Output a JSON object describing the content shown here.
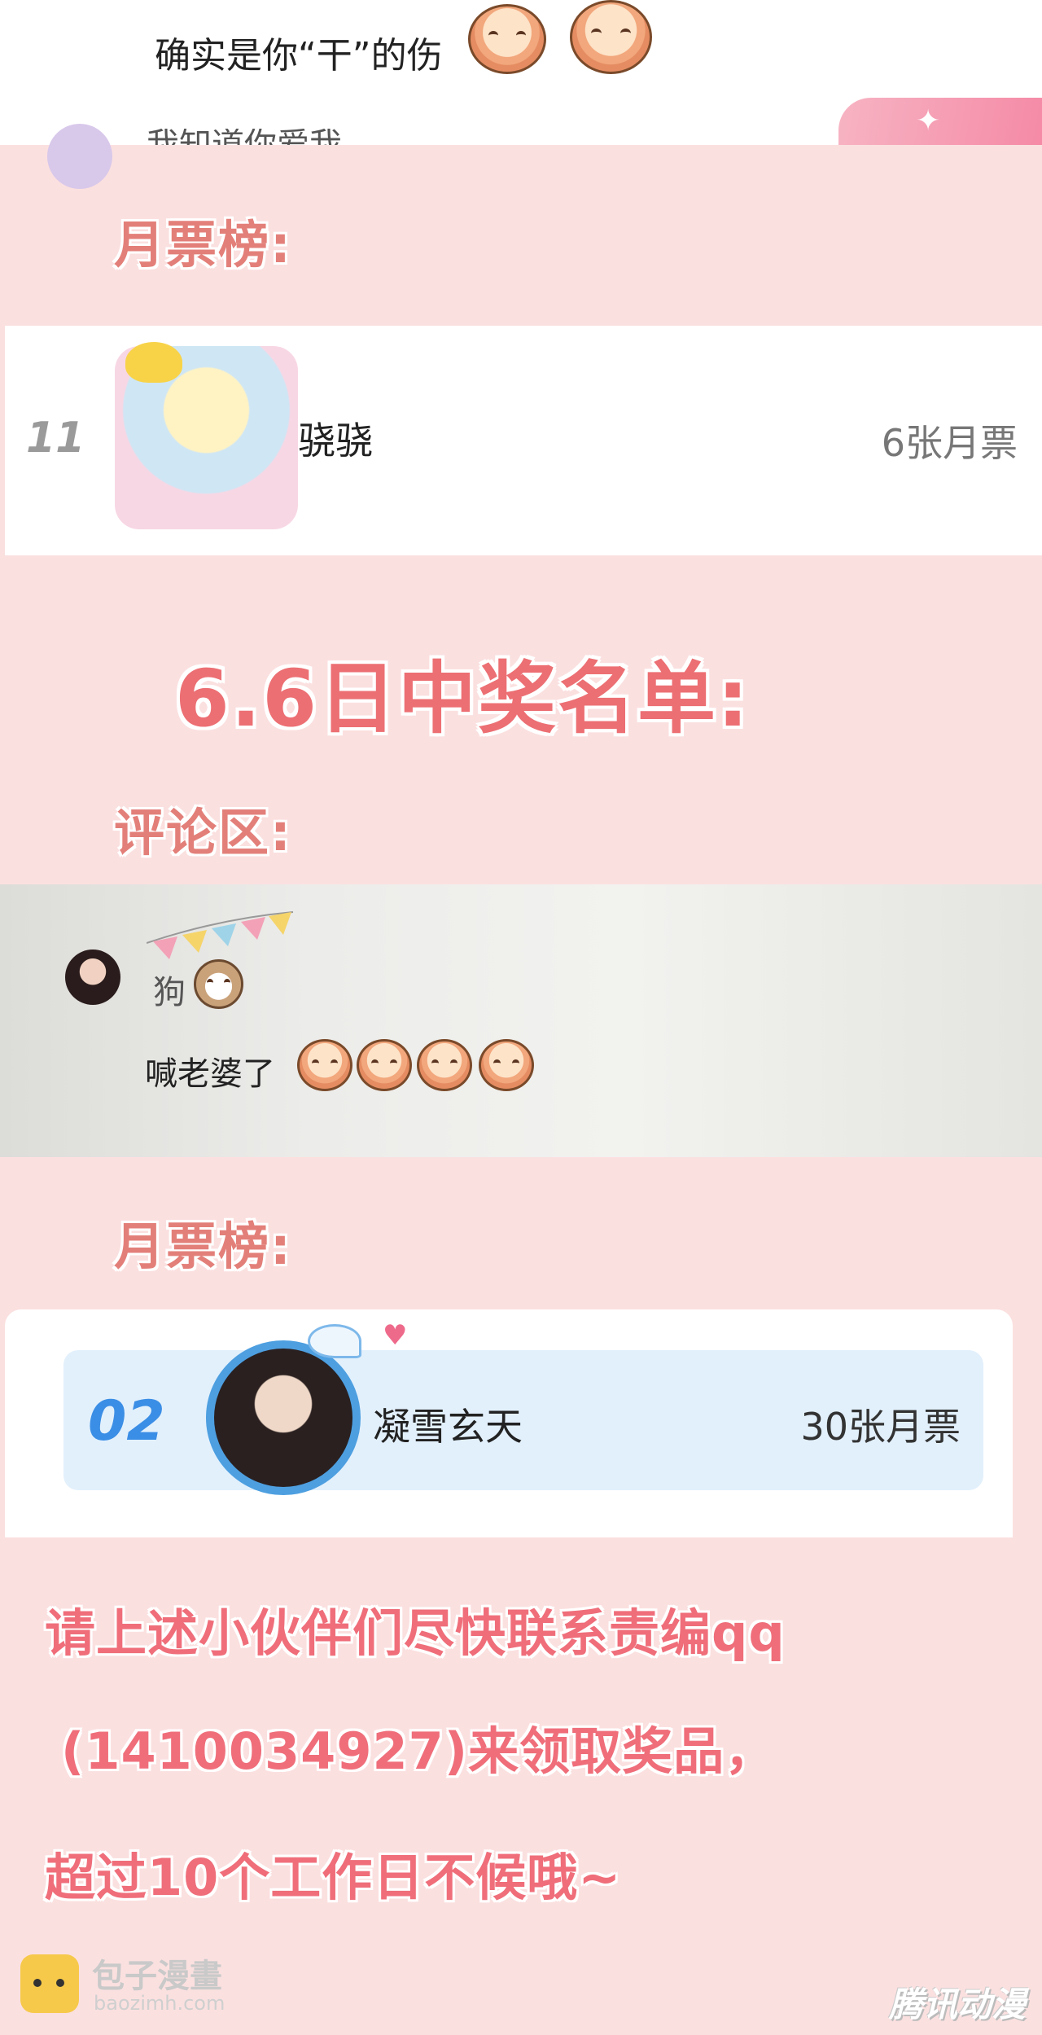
{
  "top_comment": {
    "text": "确实是你“干”的伤",
    "partial_text": "我知道你爱我"
  },
  "section_monthly_1": {
    "label": "月票榜:"
  },
  "ranking_1": {
    "rank": "11",
    "name": "骁骁",
    "votes": "6张月票"
  },
  "winner_title": "6.6日中奖名单:",
  "section_comments": {
    "label": "评论区:"
  },
  "comment": {
    "line1": "狗",
    "line2": "喊老婆了"
  },
  "section_monthly_2": {
    "label": "月票榜:"
  },
  "ranking_2": {
    "rank": "02",
    "name": "凝雪玄天",
    "votes": "30张月票"
  },
  "notice": {
    "line1": "请上述小伙伴们尽快联系责编qq",
    "line2": "(1410034927)来领取奖品，",
    "line3": "超过10个工作日不候哦~"
  },
  "watermark_left": {
    "brand": "包子漫畫",
    "url": "baozimh.com"
  },
  "watermark_right": {
    "brand": "腾讯动漫"
  },
  "colors": {
    "background": "#fbe0e0",
    "title_pink": "#ec6f73",
    "label_pink": "#e37f79",
    "rank_blue": "#3b8ee5",
    "card_blue": "#e2f0fc"
  }
}
